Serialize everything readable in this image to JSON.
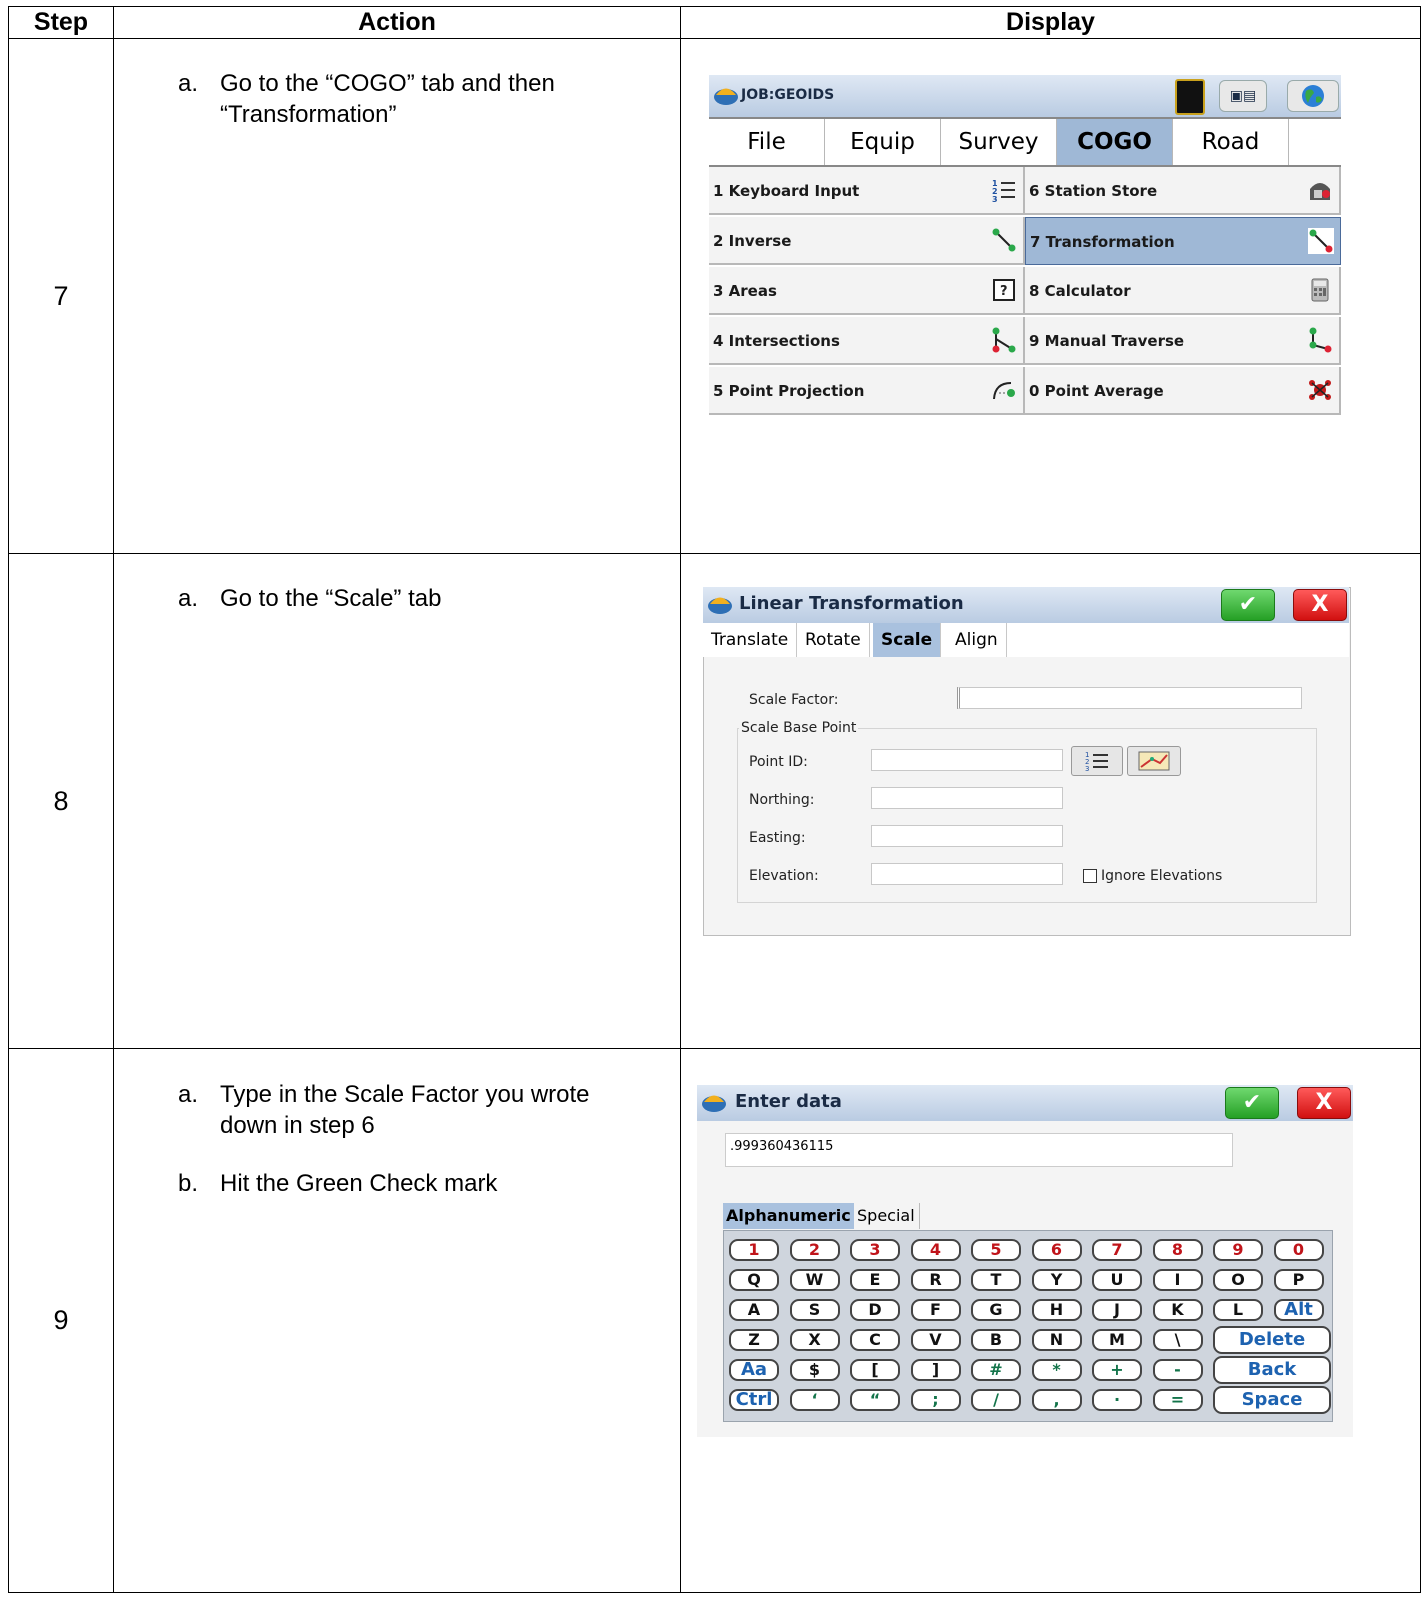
{
  "headers": {
    "step": "Step",
    "action": "Action",
    "display": "Display"
  },
  "rows": [
    {
      "step": "7",
      "items": [
        {
          "marker": "a.",
          "text": "Go to the “COGO” tab and then “Transformation”"
        }
      ]
    },
    {
      "step": "8",
      "items": [
        {
          "marker": "a.",
          "text": "Go to the “Scale” tab"
        }
      ]
    },
    {
      "step": "9",
      "items": [
        {
          "marker": "a.",
          "text": "Type in the Scale Factor you wrote down in step 6"
        },
        {
          "marker": "b.",
          "text": "Hit the Green Check mark"
        }
      ]
    }
  ],
  "screen1": {
    "title": "JOB:GEOIDS",
    "tabs": [
      "File",
      "Equip",
      "Survey",
      "COGO",
      "Road"
    ],
    "active_tab": "COGO",
    "menu_left": [
      {
        "label": "1 Keyboard Input",
        "icon": "numbered-list-icon"
      },
      {
        "label": "2 Inverse",
        "icon": "line-segment-icon"
      },
      {
        "label": "3 Areas",
        "icon": "question-box-icon"
      },
      {
        "label": "4 Intersections",
        "icon": "intersection-icon"
      },
      {
        "label": "5 Point Projection",
        "icon": "arc-point-icon"
      }
    ],
    "menu_right": [
      {
        "label": "6 Station Store",
        "icon": "station-store-icon"
      },
      {
        "label": "7 Transformation",
        "icon": "transformation-icon",
        "selected": true
      },
      {
        "label": "8 Calculator",
        "icon": "calculator-icon"
      },
      {
        "label": "9 Manual Traverse",
        "icon": "traverse-icon"
      },
      {
        "label": "0 Point Average",
        "icon": "point-average-icon"
      }
    ]
  },
  "screen2": {
    "title": "Linear Transformation",
    "ok_label": "✔",
    "cancel_label": "X",
    "tabs": [
      "Translate",
      "Rotate",
      "Scale",
      "Align"
    ],
    "active_tab": "Scale",
    "scale_factor_label": "Scale Factor:",
    "group_label": "Scale Base Point",
    "point_id_label": "Point ID:",
    "northing_label": "Northing:",
    "easting_label": "Easting:",
    "elevation_label": "Elevation:",
    "ignore_elevations_label": "Ignore Elevations"
  },
  "screen3": {
    "title": "Enter data",
    "ok_label": "✔",
    "cancel_label": "X",
    "input_value": ".999360436115",
    "tabs": [
      "Alphanumeric",
      "Special"
    ],
    "active_tab": "Alphanumeric",
    "keys": [
      [
        "1",
        "2",
        "3",
        "4",
        "5",
        "6",
        "7",
        "8",
        "9",
        "0"
      ],
      [
        "Q",
        "W",
        "E",
        "R",
        "T",
        "Y",
        "U",
        "I",
        "O",
        "P"
      ],
      [
        "A",
        "S",
        "D",
        "F",
        "G",
        "H",
        "J",
        "K",
        "L",
        "Alt"
      ],
      [
        "Z",
        "X",
        "C",
        "V",
        "B",
        "N",
        "M",
        "\\",
        "Delete"
      ],
      [
        "Aa",
        "$",
        "[",
        "]",
        "#",
        "*",
        "+",
        "-",
        "Back Space"
      ],
      [
        "Ctrl",
        "‘",
        "“",
        ";",
        "/",
        ",",
        "·",
        "=",
        "Space"
      ]
    ]
  }
}
